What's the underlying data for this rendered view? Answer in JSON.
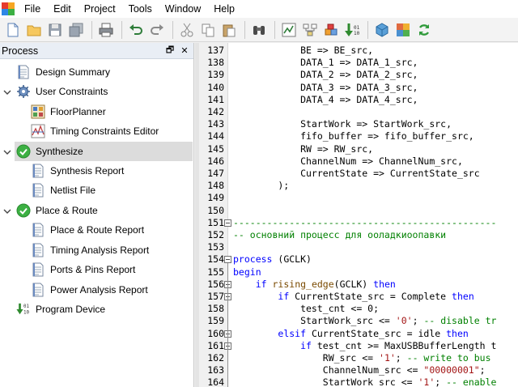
{
  "menu": [
    "File",
    "Edit",
    "Project",
    "Tools",
    "Window",
    "Help"
  ],
  "process_panel": {
    "title": "Process",
    "items": [
      {
        "label": "Design Summary",
        "icon": "document-icon"
      },
      {
        "label": "User Constraints",
        "icon": "gear-icon"
      },
      {
        "label": "FloorPlanner",
        "icon": "grid-icon"
      },
      {
        "label": "Timing Constraints Editor",
        "icon": "timing-chart-icon"
      },
      {
        "label": "Synthesize",
        "icon": "check-icon"
      },
      {
        "label": "Synthesis Report",
        "icon": "document-icon"
      },
      {
        "label": "Netlist File",
        "icon": "document-icon"
      },
      {
        "label": "Place & Route",
        "icon": "check-icon"
      },
      {
        "label": "Place & Route Report",
        "icon": "document-icon"
      },
      {
        "label": "Timing Analysis Report",
        "icon": "document-icon"
      },
      {
        "label": "Ports & Pins Report",
        "icon": "document-icon"
      },
      {
        "label": "Power Analysis Report",
        "icon": "document-icon"
      },
      {
        "label": "Program Device",
        "icon": "download-binary-icon"
      }
    ]
  },
  "editor": {
    "lines": [
      {
        "n": "137",
        "text": "            BE => BE_src,"
      },
      {
        "n": "138",
        "text": "            DATA_1 => DATA_1_src,"
      },
      {
        "n": "139",
        "text": "            DATA_2 => DATA_2_src,"
      },
      {
        "n": "140",
        "text": "            DATA_3 => DATA_3_src,"
      },
      {
        "n": "141",
        "text": "            DATA_4 => DATA_4_src,"
      },
      {
        "n": "142",
        "text": ""
      },
      {
        "n": "143",
        "text": "            StartWork => StartWork_src,"
      },
      {
        "n": "144",
        "text": "            fifo_buffer => fifo_buffer_src,"
      },
      {
        "n": "145",
        "text": "            RW => RW_src,"
      },
      {
        "n": "146",
        "text": "            ChannelNum => ChannelNum_src,"
      },
      {
        "n": "147",
        "text": "            CurrentState => CurrentState_src"
      },
      {
        "n": "148",
        "text": "        );"
      },
      {
        "n": "149",
        "text": ""
      },
      {
        "n": "150",
        "text": ""
      },
      {
        "n": "151",
        "text": "-----------------------------------------------"
      },
      {
        "n": "152",
        "text": "-- основний процесс для ооладкиоопавки"
      },
      {
        "n": "153",
        "text": ""
      },
      {
        "n": "154",
        "text": "process (GCLK)"
      },
      {
        "n": "155",
        "text": "begin"
      },
      {
        "n": "156",
        "text": "    if rising_edge(GCLK) then"
      },
      {
        "n": "157",
        "text": "        if CurrentState_src = Complete then"
      },
      {
        "n": "158",
        "text": "            test_cnt <= 0;"
      },
      {
        "n": "159",
        "text": "            StartWork_src <= '0'; -- disable tr"
      },
      {
        "n": "160",
        "text": "        elsif CurrentState_src = idle then"
      },
      {
        "n": "161",
        "text": "            if test_cnt >= MaxUSBBufferLength t"
      },
      {
        "n": "162",
        "text": "                RW_src <= '1'; -- write to bus"
      },
      {
        "n": "163",
        "text": "                ChannelNum_src <= \"00000001\";"
      },
      {
        "n": "164",
        "text": "                StartWork_src <= '1'; -- enable"
      }
    ]
  },
  "colors": {
    "keyword": "#0000ff",
    "string": "#a31515",
    "comment": "#008000",
    "function": "#7a4a00",
    "selection": "#dcdcdc",
    "check": "#3cb043"
  }
}
